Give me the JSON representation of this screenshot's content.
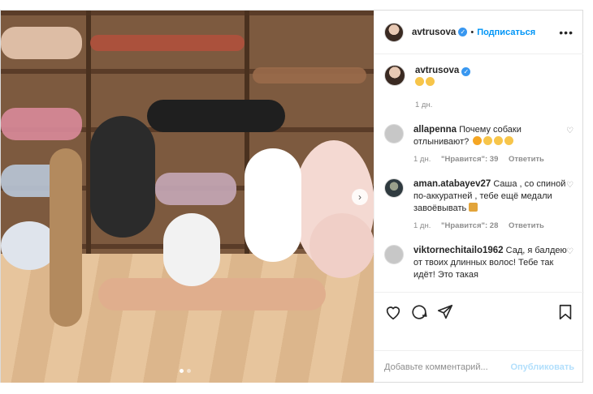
{
  "post": {
    "username": "avtrusova",
    "follow_label": "Подписаться",
    "separator": "•",
    "more_label": "•••",
    "caption_time": "1 дн.",
    "carousel_next": "›"
  },
  "comments": [
    {
      "username": "allapenna",
      "text": "Почему собаки отлынивают?",
      "time": "1 дн.",
      "likes": "\"Нравится\": 39",
      "reply": "Ответить"
    },
    {
      "username": "aman.atabayev27",
      "text": "Саша , со спиной по-аккуратней , тебе ещё медали завоёвывать",
      "time": "1 дн.",
      "likes": "\"Нравится\": 28",
      "reply": "Ответить"
    },
    {
      "username": "viktornechitailo1962",
      "text": "Сад, я балдею от твоих длинных волос! Тебе так идёт! Это такая",
      "time": "",
      "likes": "",
      "reply": ""
    }
  ],
  "add_comment": {
    "placeholder": "Добавьте комментарий...",
    "post_label": "Опубликовать"
  },
  "colors": {
    "accent": "#0095f6",
    "muted": "#8e8e8e",
    "verified": "#3897f0"
  },
  "icons": {
    "verified": "verified-badge-icon",
    "heart": "heart-icon",
    "comment": "comment-icon",
    "share": "share-icon",
    "bookmark": "bookmark-icon"
  }
}
